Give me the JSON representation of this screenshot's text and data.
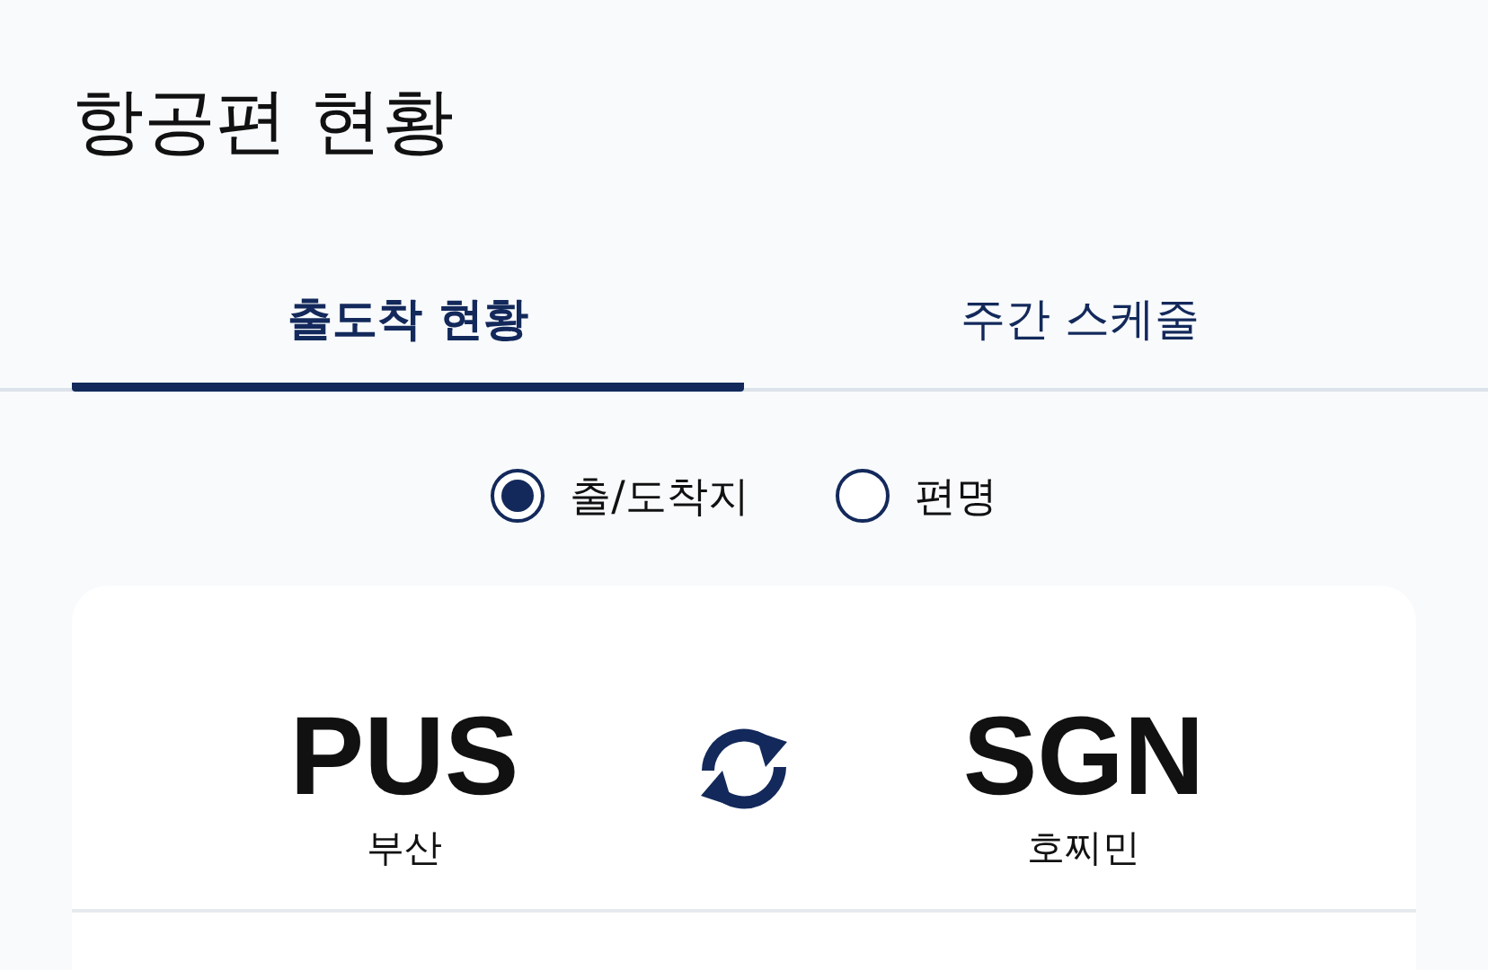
{
  "title": "항공편 현황",
  "tabs": [
    {
      "label": "출도착 현황",
      "selected": true
    },
    {
      "label": "주간 스케줄",
      "selected": false
    }
  ],
  "search_mode": [
    {
      "label": "출/도착지",
      "selected": true
    },
    {
      "label": "편명",
      "selected": false
    }
  ],
  "route": {
    "departure": {
      "code": "PUS",
      "city": "부산"
    },
    "arrival": {
      "code": "SGN",
      "city": "호찌민"
    }
  }
}
